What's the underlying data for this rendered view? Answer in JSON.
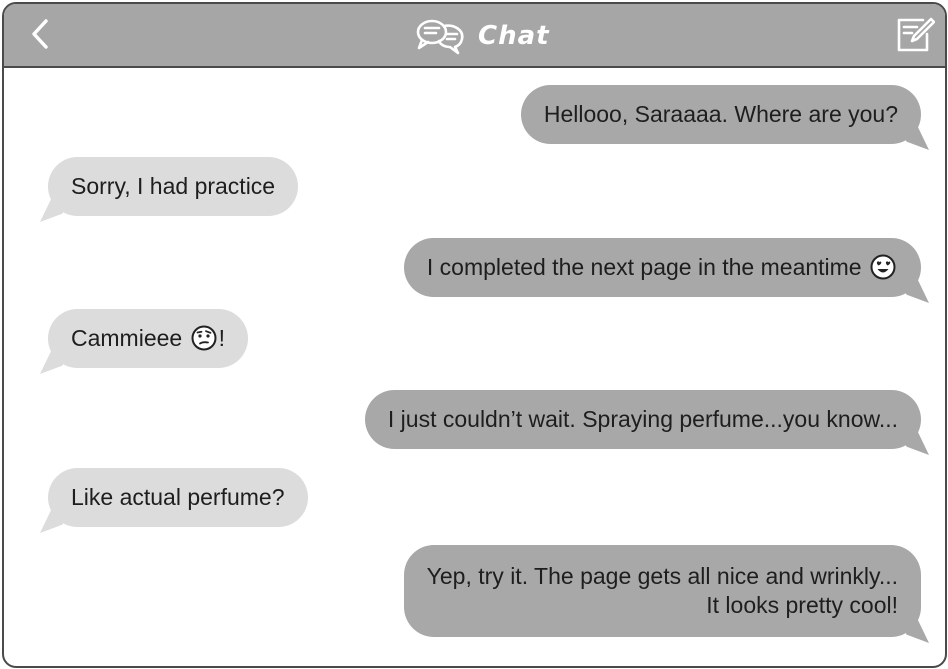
{
  "header": {
    "title": "Chat",
    "back_icon": "chevron-left-icon",
    "chat_icon": "chat-bubbles-icon",
    "compose_icon": "compose-icon"
  },
  "colors": {
    "header_bg": "#a6a6a6",
    "sent_bubble": "#a8a8a8",
    "received_bubble": "#dcdcdc",
    "border": "#4a4a4a"
  },
  "messages": [
    {
      "side": "sent",
      "text": "Hellooo, Saraaaa. Where are you?"
    },
    {
      "side": "received",
      "text": "Sorry, I had practice"
    },
    {
      "side": "sent",
      "text": "I completed the next page in the meantime",
      "emoji": "heart-eyes-emoji"
    },
    {
      "side": "received",
      "text": "Cammieee",
      "emoji": "skeptical-face-emoji",
      "suffix": "!"
    },
    {
      "side": "sent",
      "text": "I just couldn’t wait. Spraying perfume...you know..."
    },
    {
      "side": "received",
      "text": "Like actual perfume?"
    },
    {
      "side": "sent",
      "lines": [
        "Yep, try it. The page gets all nice and wrinkly...",
        "It looks pretty cool!"
      ]
    }
  ]
}
